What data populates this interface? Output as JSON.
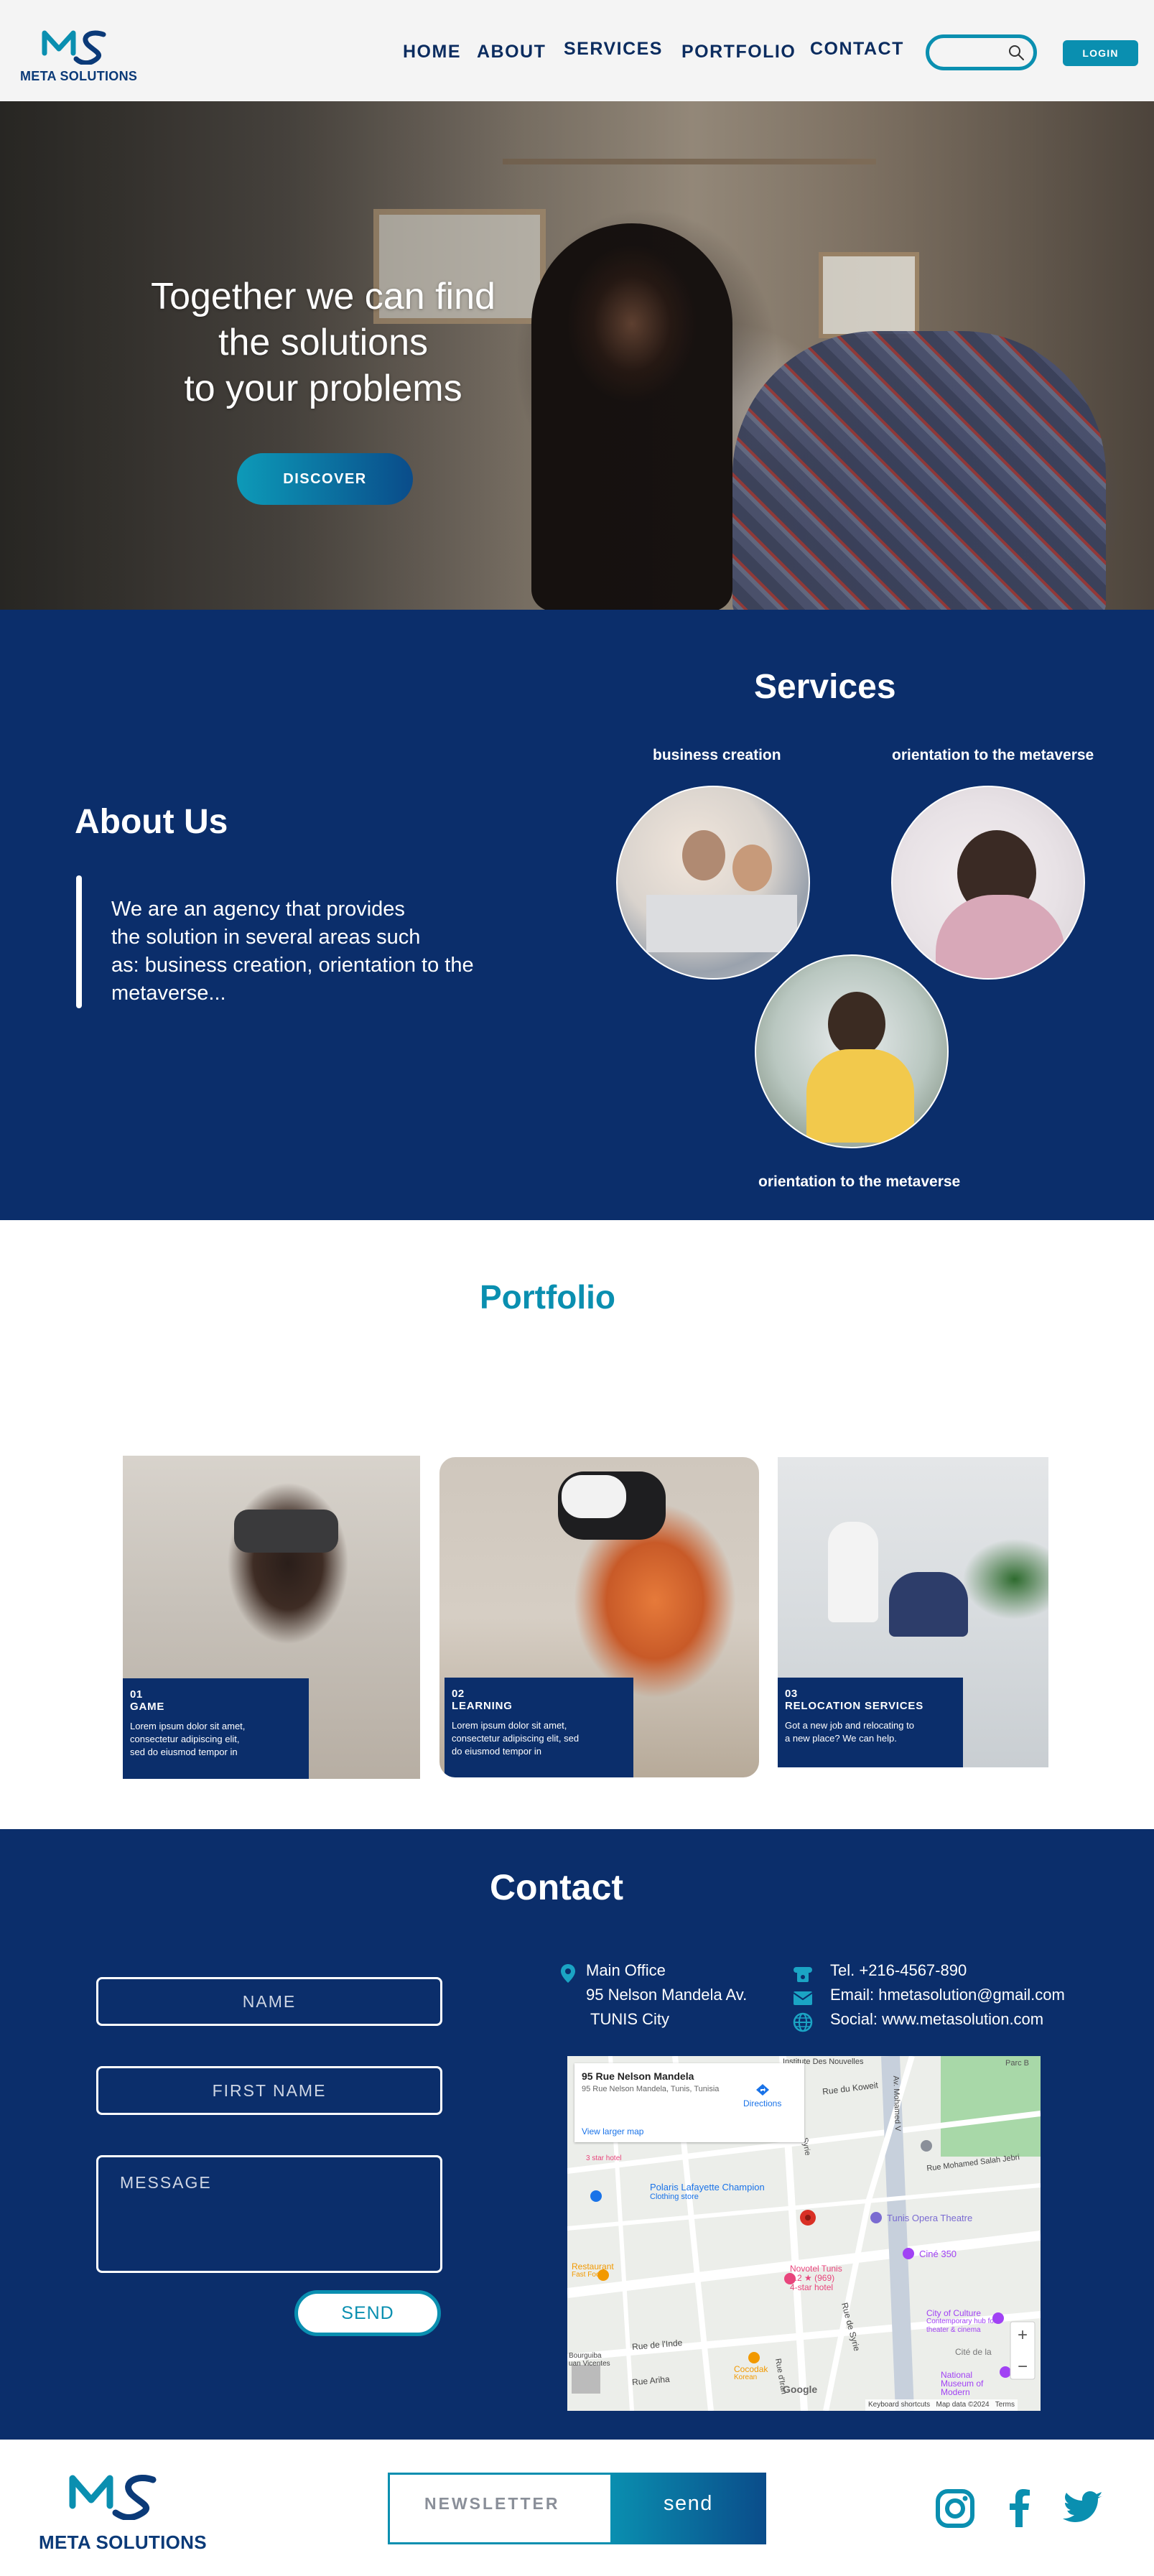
{
  "header": {
    "logo_text": "META SOLUTIONS",
    "nav": [
      "HOME",
      "ABOUT",
      "SERVICES",
      "PORTFOLIO",
      "CONTACT"
    ],
    "search_placeholder": "",
    "login_label": "LOGIN"
  },
  "hero": {
    "title_lines": [
      "Together we can find",
      "the solutions",
      "to your problems"
    ],
    "discover_label": "DISCOVER"
  },
  "about": {
    "title": "About Us",
    "text_lines": [
      "We are an agency that provides",
      "the solution in several areas such",
      "as: business creation, orientation to the",
      "metaverse..."
    ]
  },
  "services": {
    "title": "Services",
    "items": [
      {
        "label": "business creation"
      },
      {
        "label": "orientation to the metaverse"
      },
      {
        "label": "orientation to the metaverse"
      }
    ]
  },
  "portfolio": {
    "title": "Portfolio",
    "cards": [
      {
        "number": "01",
        "title": "GAME",
        "desc_lines": [
          "Lorem ipsum dolor sit amet,",
          "consectetur adipiscing elit,",
          "sed do eiusmod tempor in"
        ]
      },
      {
        "number": "02",
        "title": "LEARNING",
        "desc_lines": [
          "Lorem ipsum dolor sit amet,",
          "consectetur adipiscing elit, sed",
          "do eiusmod tempor in"
        ]
      },
      {
        "number": "03",
        "title": "RELOCATION SERVICES",
        "desc_lines": [
          "Got a new job and relocating to",
          "a new place? We can help."
        ]
      }
    ]
  },
  "contact": {
    "title": "Contact",
    "fields": {
      "name": "NAME",
      "first_name": "FIRST NAME",
      "message": "MESSAGE"
    },
    "send_label": "SEND",
    "address_lines": [
      "Main Office",
      "95 Nelson Mandela Av.",
      "TUNIS City"
    ],
    "tel": "Tel.  +216-4567-890",
    "email": "Email: hmetasolution@gmail.com",
    "social": "Social: www.metasolution.com",
    "map": {
      "place_title": "95 Rue Nelson Mandela",
      "place_address": "95 Rue Nelson Mandela, Tunis, Tunisia",
      "directions": "Directions",
      "view_larger": "View larger map",
      "labels": [
        "Polaris Lafayette Champion",
        "Clothing store",
        "Tunis Opera Theatre",
        "Ciné 350",
        "Novotel Tunis",
        "4.2 ★ (969)",
        "4-star hotel",
        "City of Culture",
        "Contemporary hub for theater & cinema",
        "Rue de l'Inde",
        "Rue Ariha",
        "Rue Mohamed Salah Jebri",
        "Rue du Koweit",
        "Rue de Syrie",
        "Cocodak",
        "Korean",
        "National Museum of Modern",
        "Cité de la",
        "Restaurant",
        "Fast Food",
        "Rue d'Iran",
        "Syrie",
        "Google",
        "Keyboard shortcuts",
        "Map data ©2024",
        "Terms",
        "Institute Des Nouvelles",
        "Av. Mohamed V",
        "Parc B",
        "3 star hotel",
        "Bourguiba",
        "uan Vicentes"
      ]
    }
  },
  "footer": {
    "logo_text": "META SOLUTIONS",
    "newsletter_placeholder": "NEWSLETTER",
    "send_label": "send",
    "social_icons": [
      "instagram-icon",
      "facebook-icon",
      "twitter-icon"
    ]
  },
  "colors": {
    "navy": "#0b2e6b",
    "teal": "#0a8fb0",
    "dark_navy_text": "#0b2c5f"
  }
}
